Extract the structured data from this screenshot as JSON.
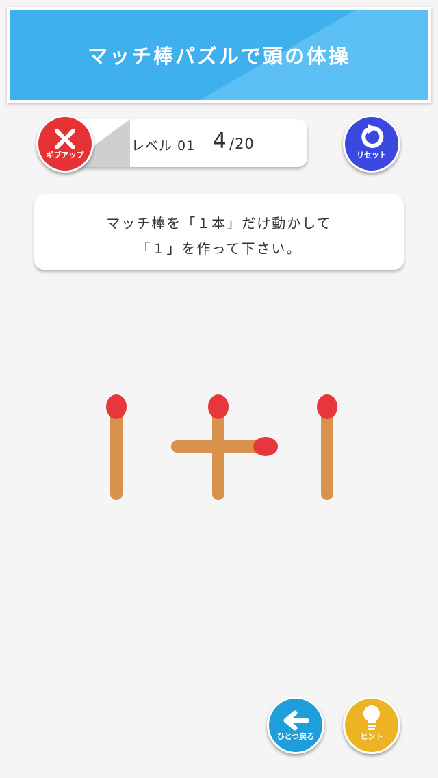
{
  "header": {
    "title": "マッチ棒パズルで頭の体操"
  },
  "level": {
    "label": "レベル 01",
    "current": "4",
    "total": "/20"
  },
  "buttons": {
    "giveup": "ギブアップ",
    "reset": "リセット",
    "undo": "ひとつ戻る",
    "hint": "ヒント"
  },
  "instruction": {
    "line1": "マッチ棒を「１本」だけ動かして",
    "line2": "「１」を作って下さい。"
  },
  "colors": {
    "header": "#3fb0ee",
    "giveup": "#e63235",
    "reset": "#3b48e0",
    "undo": "#1f9edc",
    "hint": "#ecb424",
    "match_stick": "#d9914e",
    "match_head": "#e5373c"
  }
}
